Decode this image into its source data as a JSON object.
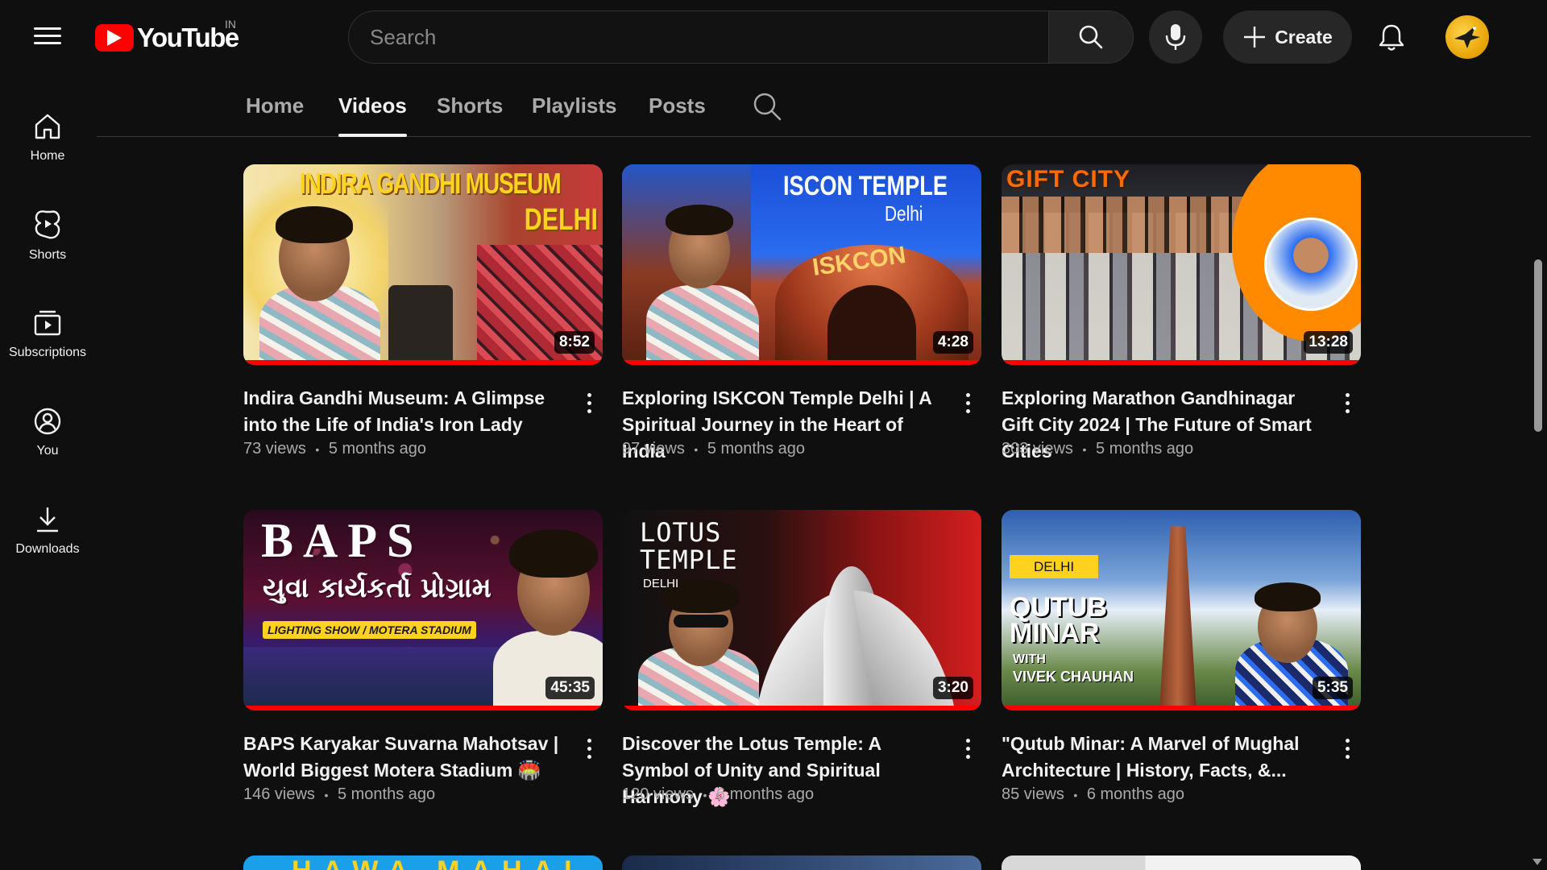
{
  "topbar": {
    "logo_text": "YouTube",
    "country_code": "IN",
    "search_placeholder": "Search",
    "create_label": "Create"
  },
  "sidebar": {
    "items": [
      {
        "label": "Home",
        "icon": "home-icon"
      },
      {
        "label": "Shorts",
        "icon": "shorts-icon"
      },
      {
        "label": "Subscriptions",
        "icon": "subscriptions-icon"
      },
      {
        "label": "You",
        "icon": "you-icon"
      },
      {
        "label": "Downloads",
        "icon": "download-icon"
      }
    ]
  },
  "tabs": {
    "items": [
      "Home",
      "Videos",
      "Shorts",
      "Playlists",
      "Posts"
    ],
    "active": "Videos"
  },
  "videos": [
    {
      "title": "Indira Gandhi Museum: A Glimpse into the Life of India's Iron Lady",
      "views": "73 views",
      "age": "5 months ago",
      "duration": "8:52",
      "thumb_text": [
        "INDIRA GANDHI MUSEUM",
        "DELHI"
      ]
    },
    {
      "title": "Exploring ISKCON Temple Delhi | A Spiritual Journey in the Heart of India",
      "views": "97 views",
      "age": "5 months ago",
      "duration": "4:28",
      "thumb_text": [
        "ISCON TEMPLE",
        "Delhi",
        "ISKCON"
      ]
    },
    {
      "title": "Exploring Marathon Gandhinagar Gift City 2024 | The Future of Smart Cities",
      "views": "303 views",
      "age": "5 months ago",
      "duration": "13:28",
      "thumb_text": [
        "GIFT CITY"
      ]
    },
    {
      "title": "BAPS Karyakar Suvarna Mahotsav | World Biggest Motera Stadium 🏟️",
      "views": "146 views",
      "age": "5 months ago",
      "duration": "45:35",
      "thumb_text": [
        "BAPS",
        "યુવા કાર્યકર્તા પ્રોગ્રામ",
        "LIGHTING SHOW / MOTERA STADIUM"
      ]
    },
    {
      "title": "Discover the Lotus Temple: A Symbol of Unity and Spiritual Harmony 🌸",
      "views": "120 views",
      "age": "6 months ago",
      "duration": "3:20",
      "thumb_text": [
        "LOTUS",
        "TEMPLE",
        "DELHI"
      ]
    },
    {
      "title": "\"Qutub Minar: A Marvel of Mughal Architecture | History, Facts, &...",
      "views": "85 views",
      "age": "6 months ago",
      "duration": "5:35",
      "thumb_text": [
        "DELHI",
        "QUTUB",
        "MINAR",
        "WITH",
        "VIVEK CHAUHAN"
      ]
    }
  ],
  "next_row_partial_text": "HAWA MAHAL",
  "meta_separator": "•",
  "colors": {
    "background": "#0f0f0f",
    "accent": "#ff0000",
    "text_primary": "#f1f1f1",
    "text_secondary": "#aaaaaa"
  }
}
